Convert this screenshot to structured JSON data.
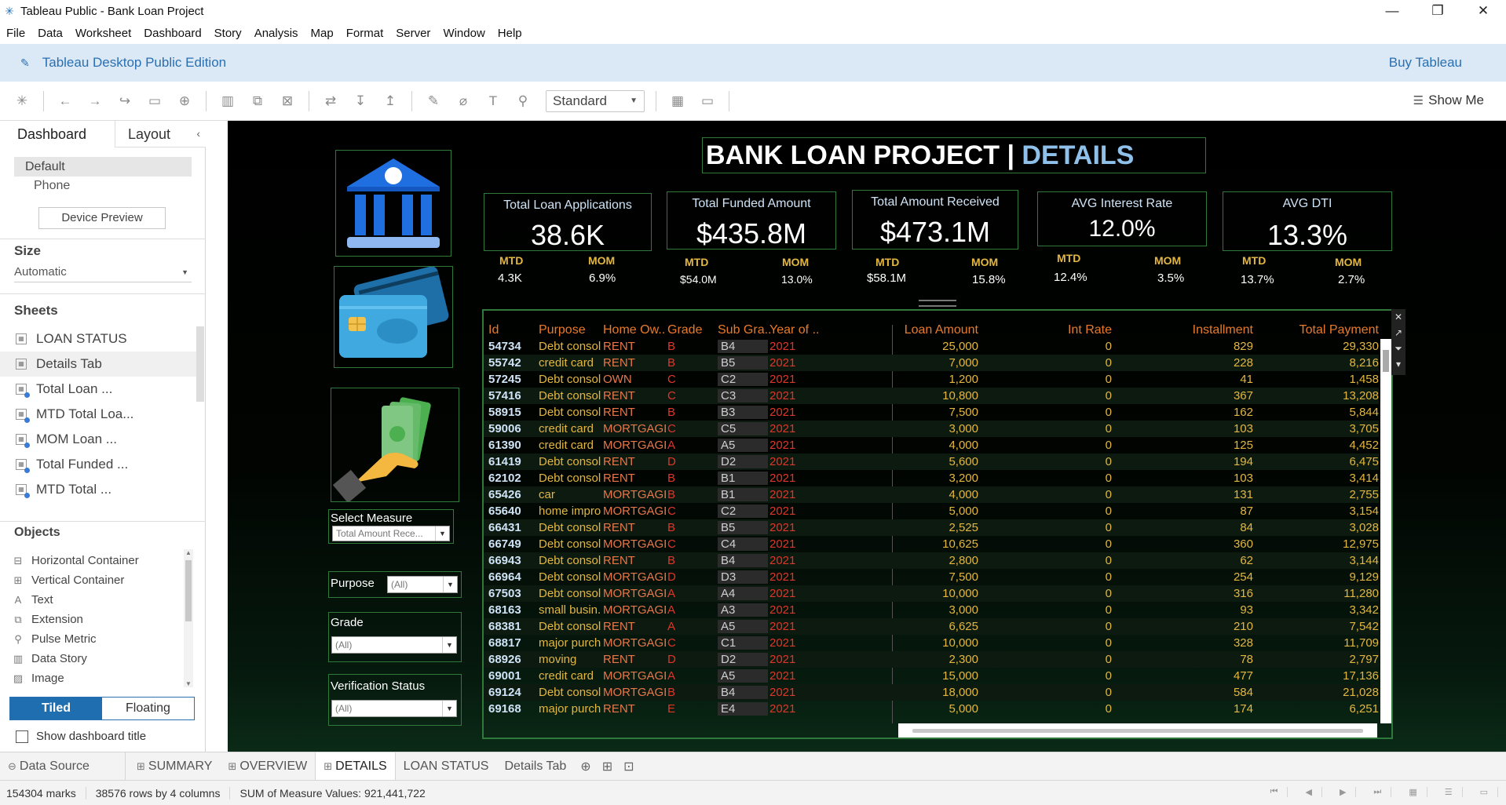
{
  "window": {
    "title": "Tableau Public - Bank Loan Project",
    "minimize": "—",
    "maximize": "❐",
    "close": "✕"
  },
  "menu": [
    "File",
    "Data",
    "Worksheet",
    "Dashboard",
    "Story",
    "Analysis",
    "Map",
    "Format",
    "Server",
    "Window",
    "Help"
  ],
  "promo": {
    "edition": "Tableau Desktop Public Edition",
    "buy": "Buy Tableau"
  },
  "toolbar": {
    "fit": "Standard",
    "show_me": "Show Me"
  },
  "left_panel": {
    "tabs": {
      "dashboard": "Dashboard",
      "layout": "Layout"
    },
    "devices": {
      "default": "Default",
      "phone": "Phone",
      "preview": "Device Preview"
    },
    "size": {
      "heading": "Size",
      "value": "Automatic"
    },
    "sheets_heading": "Sheets",
    "sheets": [
      "LOAN STATUS",
      "Details Tab",
      "Total Loan ...",
      "MTD Total Loa...",
      "MOM Loan ...",
      "Total Funded ...",
      "MTD Total ..."
    ],
    "objects_heading": "Objects",
    "objects": [
      {
        "icon": "▭▭",
        "label": "Horizontal Container"
      },
      {
        "icon": "▯",
        "label": "Vertical Container"
      },
      {
        "icon": "A",
        "label": "Text"
      },
      {
        "icon": "⧉",
        "label": "Extension"
      },
      {
        "icon": "⚲",
        "label": "Pulse Metric"
      },
      {
        "icon": "▥",
        "label": "Data Story"
      },
      {
        "icon": "▨",
        "label": "Image"
      }
    ],
    "tiled": "Tiled",
    "floating": "Floating",
    "show_title": "Show dashboard title"
  },
  "dashboard": {
    "title_main": "BANK LOAN PROJECT | ",
    "title_accent": "DETAILS",
    "accent_color": "#8fc0ea",
    "border_color": "#2f7a3a",
    "kpis": [
      {
        "label": "Total Loan Applications",
        "value": "38.6K",
        "mtd_label": "MTD",
        "mtd": "4.3K",
        "mom_label": "MOM",
        "mom": "6.9%"
      },
      {
        "label": "Total Funded Amount",
        "value": "$435.8M",
        "mtd_label": "MTD",
        "mtd": "$54.0M",
        "mom_label": "MOM",
        "mom": "13.0%"
      },
      {
        "label": "Total Amount Received",
        "value": "$473.1M",
        "mtd_label": "MTD",
        "mtd": "$58.1M",
        "mom_label": "MOM",
        "mom": "15.8%"
      },
      {
        "label": "AVG Interest Rate",
        "value": "12.0%",
        "mtd_label": "MTD",
        "mtd": "12.4%",
        "mom_label": "MOM",
        "mom": "3.5%"
      },
      {
        "label": "AVG DTI",
        "value": "13.3%",
        "mtd_label": "MTD",
        "mtd": "13.7%",
        "mom_label": "MOM",
        "mom": "2.7%"
      }
    ],
    "filters": {
      "measure": {
        "label": "Select Measure",
        "value": "Total Amount Rece..."
      },
      "purpose": {
        "label": "Purpose",
        "value": "(All)"
      },
      "grade": {
        "label": "Grade",
        "value": "(All)"
      },
      "verification": {
        "label": "Verification Status",
        "value": "(All)"
      }
    },
    "table": {
      "headers": [
        "Id",
        "Purpose",
        "Home Ow..",
        "Grade",
        "Sub Gra..",
        "Year of ..",
        "Loan Amount",
        "Int Rate",
        "Installment",
        "Total Payment"
      ],
      "rows": [
        [
          "54734",
          "Debt consol..",
          "RENT",
          "B",
          "B4",
          "2021",
          "25,000",
          "0",
          "829",
          "29,330"
        ],
        [
          "55742",
          "credit card",
          "RENT",
          "B",
          "B5",
          "2021",
          "7,000",
          "0",
          "228",
          "8,216"
        ],
        [
          "57245",
          "Debt consol..",
          "OWN",
          "C",
          "C2",
          "2021",
          "1,200",
          "0",
          "41",
          "1,458"
        ],
        [
          "57416",
          "Debt consol..",
          "RENT",
          "C",
          "C3",
          "2021",
          "10,800",
          "0",
          "367",
          "13,208"
        ],
        [
          "58915",
          "Debt consol..",
          "RENT",
          "B",
          "B3",
          "2021",
          "7,500",
          "0",
          "162",
          "5,844"
        ],
        [
          "59006",
          "credit card",
          "MORTGAGE",
          "C",
          "C5",
          "2021",
          "3,000",
          "0",
          "103",
          "3,705"
        ],
        [
          "61390",
          "credit card",
          "MORTGAGE",
          "A",
          "A5",
          "2021",
          "4,000",
          "0",
          "125",
          "4,452"
        ],
        [
          "61419",
          "Debt consol..",
          "RENT",
          "D",
          "D2",
          "2021",
          "5,600",
          "0",
          "194",
          "6,475"
        ],
        [
          "62102",
          "Debt consol..",
          "RENT",
          "B",
          "B1",
          "2021",
          "3,200",
          "0",
          "103",
          "3,414"
        ],
        [
          "65426",
          "car",
          "MORTGAGE",
          "B",
          "B1",
          "2021",
          "4,000",
          "0",
          "131",
          "2,755"
        ],
        [
          "65640",
          "home impro..",
          "MORTGAGE",
          "C",
          "C2",
          "2021",
          "5,000",
          "0",
          "87",
          "3,154"
        ],
        [
          "66431",
          "Debt consol..",
          "RENT",
          "B",
          "B5",
          "2021",
          "2,525",
          "0",
          "84",
          "3,028"
        ],
        [
          "66749",
          "Debt consol..",
          "MORTGAGE",
          "C",
          "C4",
          "2021",
          "10,625",
          "0",
          "360",
          "12,975"
        ],
        [
          "66943",
          "Debt consol..",
          "RENT",
          "B",
          "B4",
          "2021",
          "2,800",
          "0",
          "62",
          "3,144"
        ],
        [
          "66964",
          "Debt consol..",
          "MORTGAGE",
          "D",
          "D3",
          "2021",
          "7,500",
          "0",
          "254",
          "9,129"
        ],
        [
          "67503",
          "Debt consol..",
          "MORTGAGE",
          "A",
          "A4",
          "2021",
          "10,000",
          "0",
          "316",
          "11,280"
        ],
        [
          "68163",
          "small busin..",
          "MORTGAGE",
          "A",
          "A3",
          "2021",
          "3,000",
          "0",
          "93",
          "3,342"
        ],
        [
          "68381",
          "Debt consol..",
          "RENT",
          "A",
          "A5",
          "2021",
          "6,625",
          "0",
          "210",
          "7,542"
        ],
        [
          "68817",
          "major purch..",
          "MORTGAGE",
          "C",
          "C1",
          "2021",
          "10,000",
          "0",
          "328",
          "11,709"
        ],
        [
          "68926",
          "moving",
          "RENT",
          "D",
          "D2",
          "2021",
          "2,300",
          "0",
          "78",
          "2,797"
        ],
        [
          "69001",
          "credit card",
          "MORTGAGE",
          "A",
          "A5",
          "2021",
          "15,000",
          "0",
          "477",
          "17,136"
        ],
        [
          "69124",
          "Debt consol..",
          "MORTGAGE",
          "B",
          "B4",
          "2021",
          "18,000",
          "0",
          "584",
          "21,028"
        ],
        [
          "69168",
          "major purch..",
          "RENT",
          "E",
          "E4",
          "2021",
          "5,000",
          "0",
          "174",
          "6,251"
        ]
      ]
    }
  },
  "bottom_tabs": {
    "data_source": "Data Source",
    "tabs": [
      "SUMMARY",
      "OVERVIEW",
      "DETAILS",
      "LOAN STATUS",
      "Details Tab"
    ],
    "active": "DETAILS"
  },
  "status": {
    "marks": "154304 marks",
    "rows": "38576 rows by 4 columns",
    "sum": "SUM of Measure Values: 921,441,722"
  }
}
